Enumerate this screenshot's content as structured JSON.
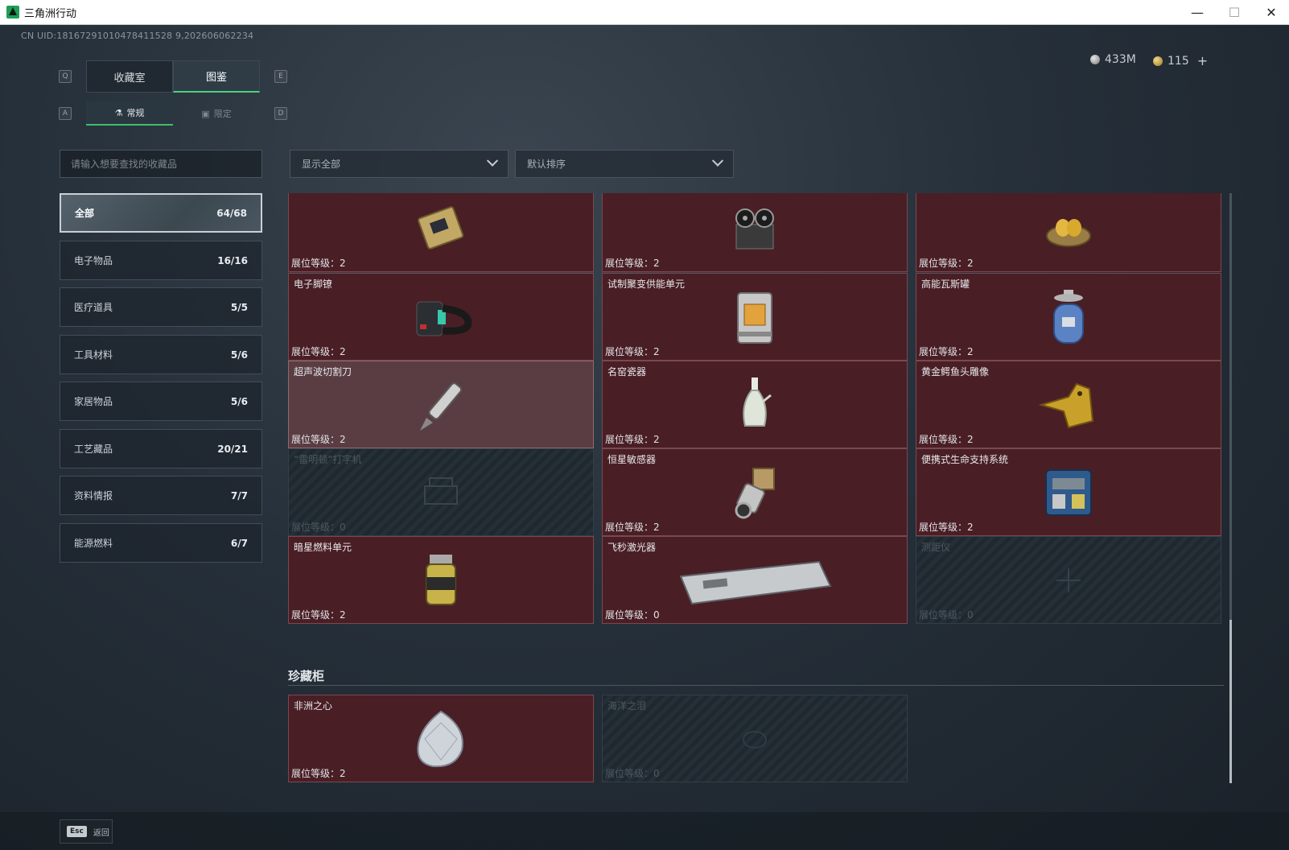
{
  "window": {
    "title": "三角洲行动"
  },
  "uid_text": "CN UID:18167291010478411528 9,202606062234",
  "currency": {
    "silver": "433M",
    "gold": "115",
    "add": "+"
  },
  "tabs_top": {
    "left_key": "Q",
    "right_key": "E",
    "items": [
      {
        "label": "收藏室"
      },
      {
        "label": "图鉴"
      }
    ]
  },
  "tabs_sub": {
    "left_key": "A",
    "right_key": "D",
    "items": [
      {
        "label": "常规"
      },
      {
        "label": "限定"
      }
    ]
  },
  "search": {
    "placeholder": "请输入想要查找的收藏品"
  },
  "filters": {
    "display": "显示全部",
    "sort": "默认排序"
  },
  "categories": [
    {
      "label": "全部",
      "count": "64/68"
    },
    {
      "label": "电子物品",
      "count": "16/16"
    },
    {
      "label": "医疗道具",
      "count": "5/5"
    },
    {
      "label": "工具材料",
      "count": "5/6"
    },
    {
      "label": "家居物品",
      "count": "5/6"
    },
    {
      "label": "工艺藏品",
      "count": "20/21"
    },
    {
      "label": "资料情报",
      "count": "7/7"
    },
    {
      "label": "能源燃料",
      "count": "6/7"
    }
  ],
  "items": [
    {
      "name": "",
      "level": "展位等级：2",
      "icon": "circuit-board-icon",
      "state": "owned"
    },
    {
      "name": "",
      "level": "展位等级：2",
      "icon": "tape-recorder-icon",
      "state": "owned"
    },
    {
      "name": "",
      "level": "展位等级：2",
      "icon": "golden-egg-nest-icon",
      "state": "owned"
    },
    {
      "name": "电子脚镣",
      "level": "展位等级：2",
      "icon": "electronic-anklet-icon",
      "state": "owned"
    },
    {
      "name": "试制聚变供能单元",
      "level": "展位等级：2",
      "icon": "fusion-unit-icon",
      "state": "owned"
    },
    {
      "name": "高能瓦斯罐",
      "level": "展位等级：2",
      "icon": "gas-canister-icon",
      "state": "owned"
    },
    {
      "name": "超声波切割刀",
      "level": "展位等级：2",
      "icon": "ultrasonic-cutter-icon",
      "state": "highlighted"
    },
    {
      "name": "名窑瓷器",
      "level": "展位等级：2",
      "icon": "porcelain-vase-icon",
      "state": "owned"
    },
    {
      "name": "黄金鳄鱼头雕像",
      "level": "展位等级：2",
      "icon": "golden-crocodile-icon",
      "state": "owned"
    },
    {
      "name": "“雷明顿”打字机",
      "level": "展位等级：0",
      "icon": "typewriter-icon",
      "state": "locked"
    },
    {
      "name": "恒星敏感器",
      "level": "展位等级：2",
      "icon": "star-sensor-icon",
      "state": "owned"
    },
    {
      "name": "便携式生命支持系统",
      "level": "展位等级：2",
      "icon": "life-support-icon",
      "state": "owned"
    },
    {
      "name": "暗星燃料单元",
      "level": "展位等级：2",
      "icon": "fuel-cell-icon",
      "state": "owned"
    },
    {
      "name": "飞秒激光器",
      "level": "展位等级：0",
      "icon": "femtosecond-laser-icon",
      "state": "owned"
    },
    {
      "name": "测距仪",
      "level": "展位等级：0",
      "icon": "rangefinder-icon",
      "state": "locked"
    }
  ],
  "treasure_section": {
    "title": "珍藏柜",
    "items": [
      {
        "name": "非洲之心",
        "level": "展位等级：2",
        "icon": "diamond-icon",
        "state": "owned"
      },
      {
        "name": "海洋之泪",
        "level": "展位等级：0",
        "icon": "ocean-tear-icon",
        "state": "locked"
      }
    ]
  },
  "footer": {
    "esc_key": "Esc",
    "back_label": "返回"
  },
  "colors": {
    "accent": "#4bd17c",
    "owned_card": "#4a1e25",
    "locked_card": "#1f282f"
  }
}
